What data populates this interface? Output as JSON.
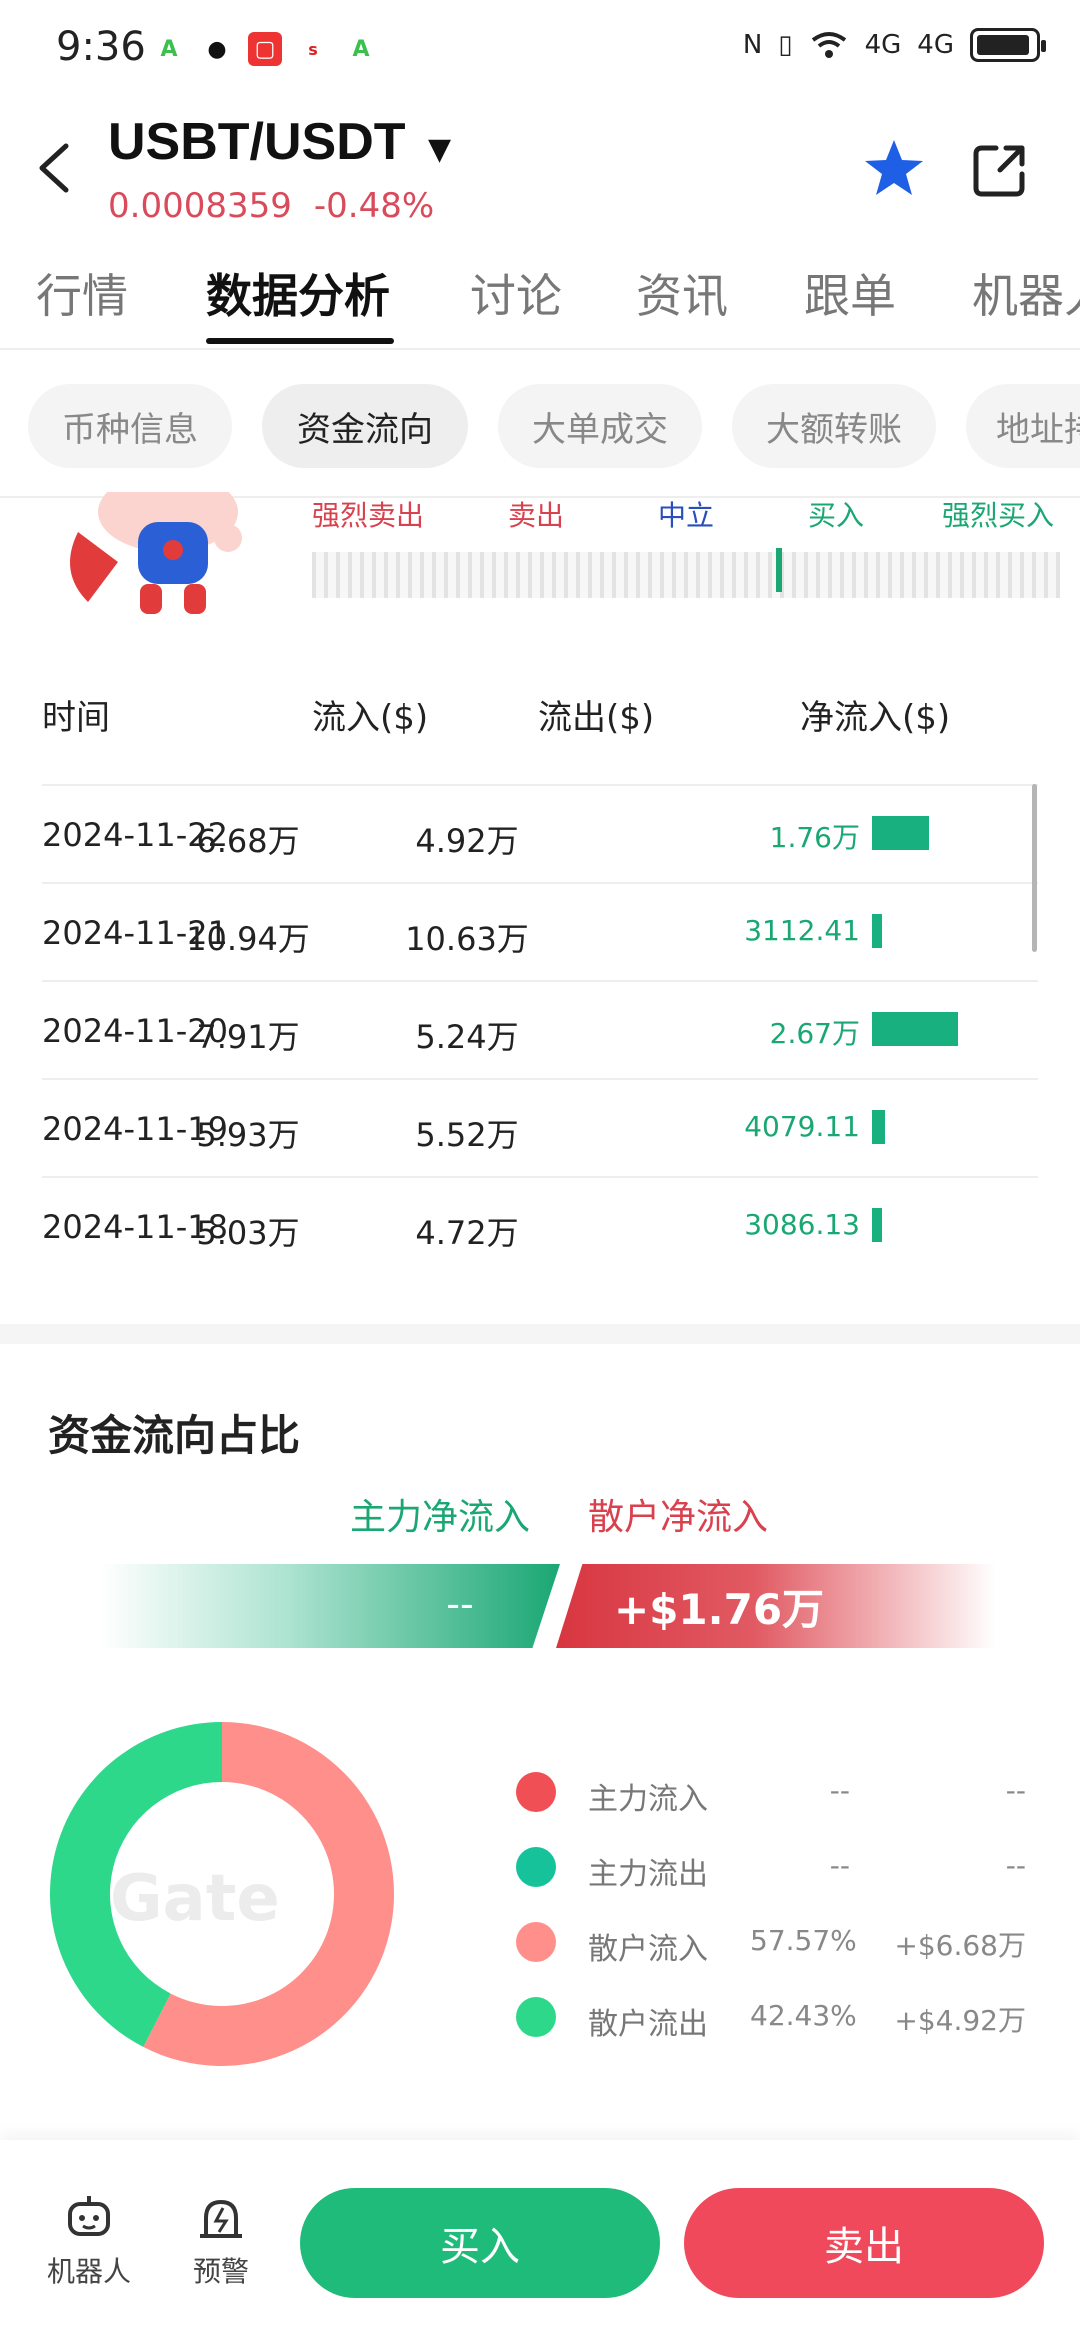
{
  "status_bar": {
    "time": "9:36",
    "network_1": "4G",
    "network_2": "4G"
  },
  "header": {
    "pair": "USBT/USDT",
    "price": "0.0008359",
    "change": "-0.48%",
    "colors": {
      "down": "#d94b5b",
      "star": "#1f5fe6"
    }
  },
  "main_tabs": [
    "行情",
    "数据分析",
    "讨论",
    "资讯",
    "跟单",
    "机器人"
  ],
  "sub_tabs": [
    "币种信息",
    "资金流向",
    "大单成交",
    "大额转账",
    "地址持仓"
  ],
  "sentiment": {
    "labels": [
      "强烈卖出",
      "卖出",
      "中立",
      "买入",
      "强烈买入"
    ],
    "indicator_fraction": 0.62
  },
  "flow_table": {
    "headers": [
      "时间",
      "流入($)",
      "流出($)",
      "净流入($)"
    ],
    "rows": [
      {
        "date": "2024-11-22",
        "inflow": "6.68万",
        "outflow": "4.92万",
        "net": "1.76万",
        "net_value": 17600
      },
      {
        "date": "2024-11-21",
        "inflow": "10.94万",
        "outflow": "10.63万",
        "net": "3112.41",
        "net_value": 3112.41
      },
      {
        "date": "2024-11-20",
        "inflow": "7.91万",
        "outflow": "5.24万",
        "net": "2.67万",
        "net_value": 26700
      },
      {
        "date": "2024-11-19",
        "inflow": "5.93万",
        "outflow": "5.52万",
        "net": "4079.11",
        "net_value": 4079.11
      },
      {
        "date": "2024-11-18",
        "inflow": "5.03万",
        "outflow": "4.72万",
        "net": "3086.13",
        "net_value": 3086.13
      }
    ]
  },
  "ratio": {
    "title": "资金流向占比",
    "main_net_label": "主力净流入",
    "retail_net_label": "散户净流入",
    "main_net_value": "--",
    "retail_net_value": "+$1.76万",
    "watermark": "Gate",
    "legend": [
      {
        "name": "主力流入",
        "pct": "--",
        "amount": "--",
        "color": "#ef4f55"
      },
      {
        "name": "主力流出",
        "pct": "--",
        "amount": "--",
        "color": "#16c29a"
      },
      {
        "name": "散户流入",
        "pct": "57.57%",
        "amount": "+$6.68万",
        "color": "#ff8f8a"
      },
      {
        "name": "散户流出",
        "pct": "42.43%",
        "amount": "+$4.92万",
        "color": "#2dd88a"
      }
    ],
    "donut": [
      {
        "name": "散户流入",
        "value": 57.57,
        "color": "#ff8f8a"
      },
      {
        "name": "散户流出",
        "value": 42.43,
        "color": "#2dd88a"
      }
    ]
  },
  "bottom_bar": {
    "robot_label": "机器人",
    "alert_label": "预警",
    "buy_label": "买入",
    "sell_label": "卖出"
  }
}
